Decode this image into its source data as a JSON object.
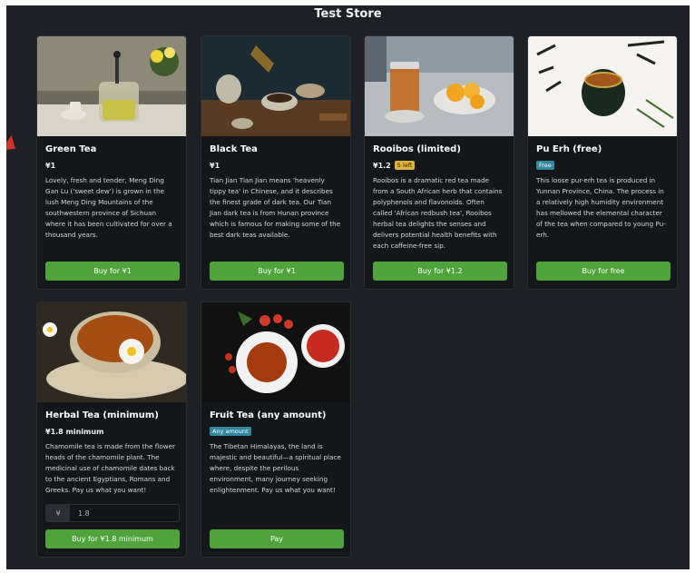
{
  "store": {
    "title": "Test Store"
  },
  "colors": {
    "background": "#1d2024",
    "card": "#14171a",
    "button": "#4fa33a",
    "badge_stock": "#e0b43a",
    "badge_free": "#3288a0"
  },
  "products": [
    {
      "name": "Green Tea",
      "price": "¥1",
      "badge": "",
      "description": "Lovely, fresh and tender, Meng Ding Gan Lu ('sweet dew') is grown in the lush Meng Ding Mountains of the southwestern province of Sichuan where it has been cultivated for over a thousand years.",
      "button": "Buy for ¥1"
    },
    {
      "name": "Black Tea",
      "price": "¥1",
      "badge": "",
      "description": "Tian Jian Tian Jian means 'heavenly tippy tea' in Chinese, and it describes the finest grade of dark tea. Our Tian Jian dark tea is from Hunan province which is famous for making some of the best dark teas available.",
      "button": "Buy for ¥1"
    },
    {
      "name": "Rooibos (limited)",
      "price": "¥1.2",
      "badge": "5 left",
      "description": "Rooibos is a dramatic red tea made from a South African herb that contains polyphenols and flavonoids. Often called 'African redbush tea', Rooibos herbal tea delights the senses and delivers potential health benefits with each caffeine-free sip.",
      "button": "Buy for ¥1.2"
    },
    {
      "name": "Pu Erh (free)",
      "price": "",
      "badge": "Free",
      "description": "This loose pur-erh tea is produced in Yunnan Province, China. The process in a relatively high humidity environment has mellowed the elemental character of the tea when compared to young Pu-erh.",
      "button": "Buy for free"
    },
    {
      "name": "Herbal Tea (minimum)",
      "price": "¥1.8 minimum",
      "badge": "",
      "description": "Chamomile tea is made from the flower heads of the chamomile plant. The medicinal use of chamomile dates back to the ancient Egyptians, Romans and Greeks. Pay us what you want!",
      "amount_currency": "¥",
      "amount_value": "1.8",
      "button": "Buy for ¥1.8 minimum"
    },
    {
      "name": "Fruit Tea (any amount)",
      "price": "",
      "badge": "Any amount",
      "description": "The Tibetan Himalayas, the land is majestic and beautiful—a spiritual place where, despite the perilous environment, many journey seeking enlightenment. Pay us what you want!",
      "button": "Pay"
    }
  ]
}
